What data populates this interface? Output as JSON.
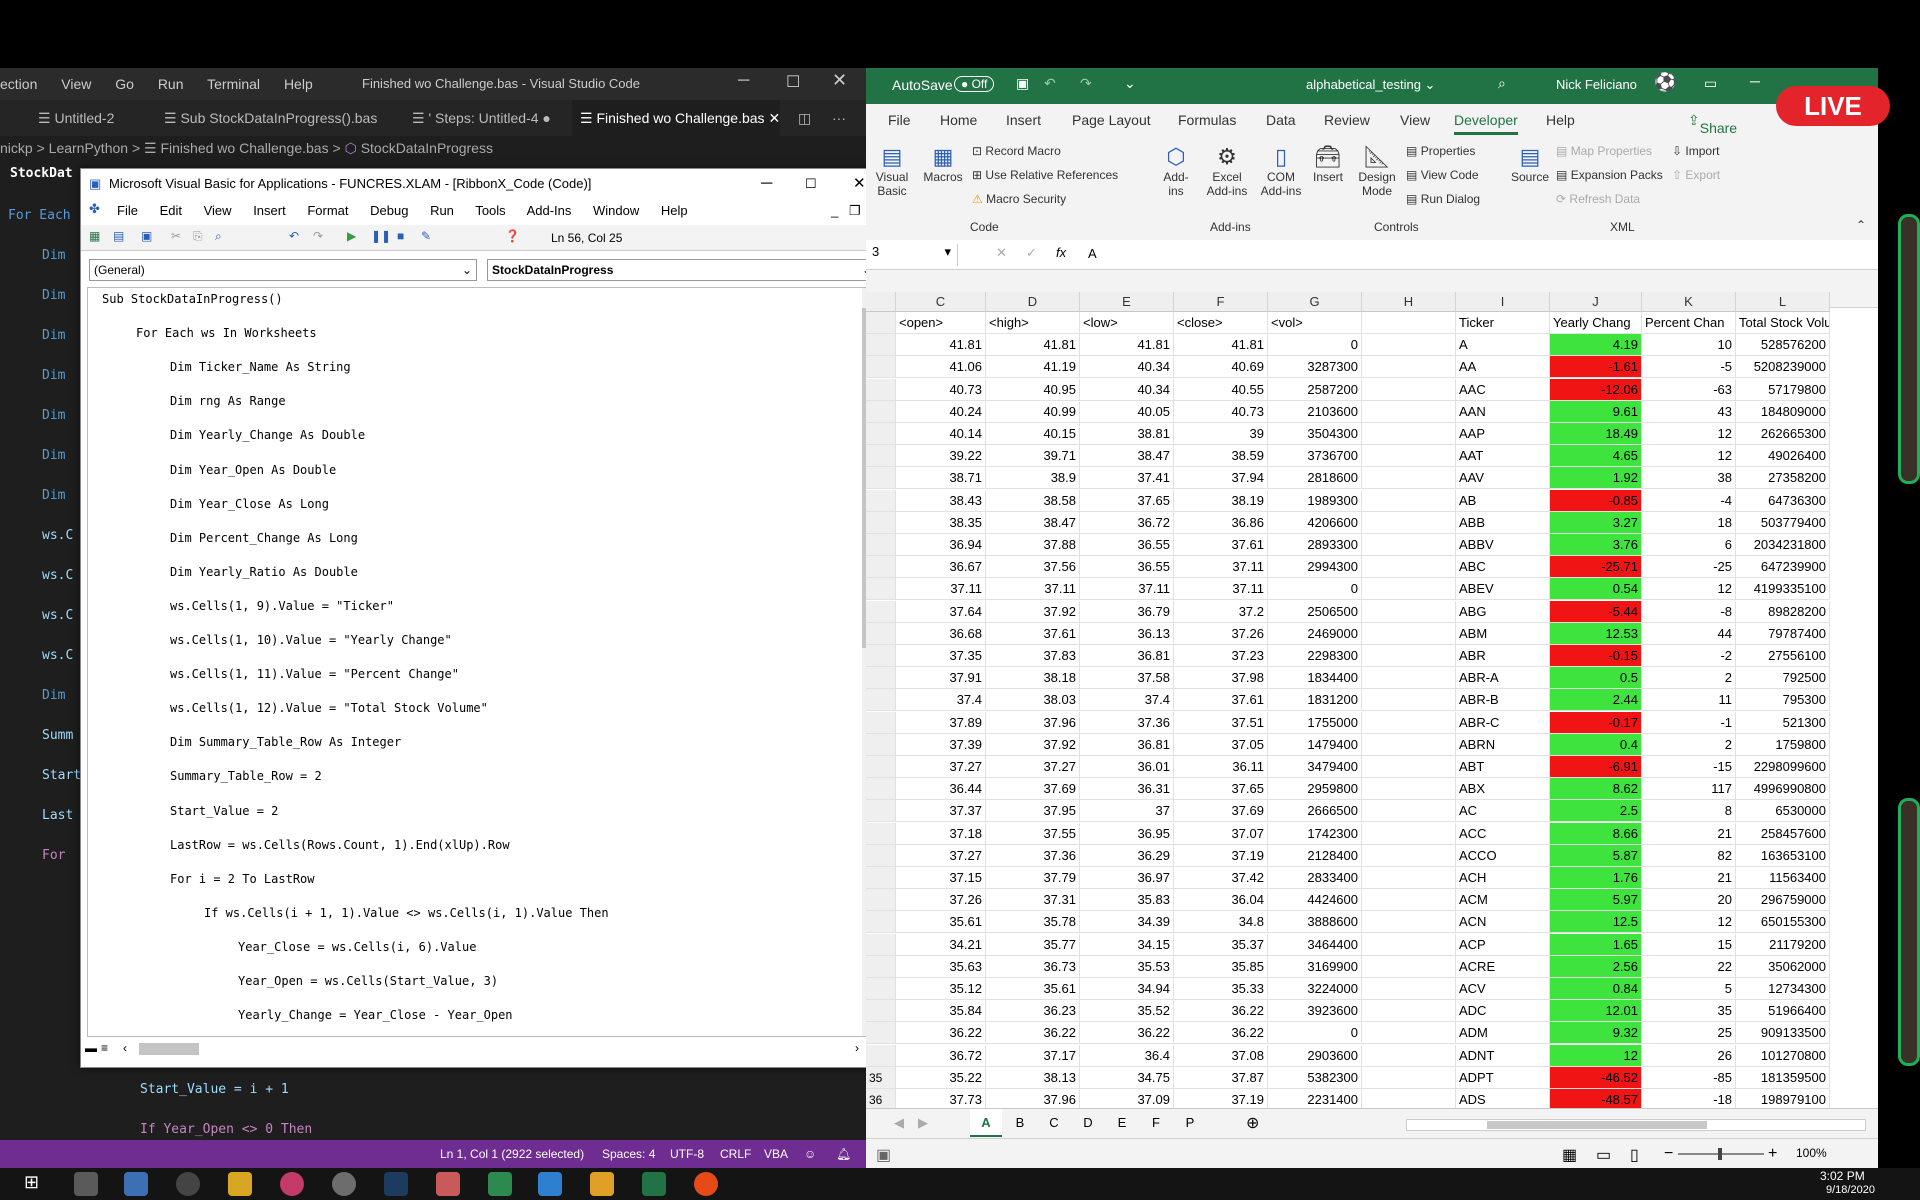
{
  "vscode": {
    "menu": [
      "ection",
      "View",
      "Go",
      "Run",
      "Terminal",
      "Help"
    ],
    "title": "Finished wo Challenge.bas - Visual Studio Code",
    "tabs": [
      "Untitled-2",
      "Sub StockDataInProgress().bas",
      "' Steps: Untitled-4",
      "Finished wo Challenge.bas"
    ],
    "breadcrumb": [
      "nickp",
      "LearnPython",
      "Finished wo Challenge.bas",
      "StockDataInProgress"
    ],
    "outline_label": "StockDat",
    "code_fragments": [
      "For Each",
      "Dim",
      "Dim",
      "Dim",
      "Dim",
      "Dim",
      "Dim",
      "Dim",
      "ws.C",
      "ws.C",
      "ws.C",
      "ws.C",
      "Dim",
      "Summ",
      "Start",
      "Last",
      "For"
    ],
    "bottom_lines": [
      "Start_Value = i + 1",
      "If Year_Open <> 0 Then"
    ],
    "status": [
      "Ln 1, Col 1 (2922 selected)",
      "Spaces: 4",
      "UTF-8",
      "CRLF",
      "VBA"
    ]
  },
  "vba": {
    "title": "Microsoft Visual Basic for Applications - FUNCRES.XLAM - [RibbonX_Code (Code)]",
    "menu": [
      "File",
      "Edit",
      "View",
      "Insert",
      "Format",
      "Debug",
      "Run",
      "Tools",
      "Add-Ins",
      "Window",
      "Help"
    ],
    "position": "Ln 56, Col 25",
    "combo_left": "(General)",
    "combo_right": "StockDataInProgress",
    "code": [
      {
        "indent": 0,
        "text": "Sub StockDataInProgress()"
      },
      {
        "indent": 1,
        "text": "For Each ws In Worksheets"
      },
      {
        "indent": 2,
        "text": "Dim Ticker_Name As String"
      },
      {
        "indent": 2,
        "text": "Dim rng As Range"
      },
      {
        "indent": 2,
        "text": "Dim Yearly_Change As Double"
      },
      {
        "indent": 2,
        "text": "Dim Year_Open As Double"
      },
      {
        "indent": 2,
        "text": "Dim Year_Close As Long"
      },
      {
        "indent": 2,
        "text": "Dim Percent_Change As Long"
      },
      {
        "indent": 2,
        "text": "Dim Yearly_Ratio As Double"
      },
      {
        "indent": 2,
        "text": "ws.Cells(1, 9).Value = \"Ticker\""
      },
      {
        "indent": 2,
        "text": "ws.Cells(1, 10).Value = \"Yearly Change\""
      },
      {
        "indent": 2,
        "text": "ws.Cells(1, 11).Value = \"Percent Change\""
      },
      {
        "indent": 2,
        "text": "ws.Cells(1, 12).Value = \"Total Stock Volume\""
      },
      {
        "indent": 2,
        "text": "Dim Summary_Table_Row As Integer"
      },
      {
        "indent": 2,
        "text": "Summary_Table_Row = 2"
      },
      {
        "indent": 2,
        "text": "Start_Value = 2"
      },
      {
        "indent": 2,
        "text": "LastRow = ws.Cells(Rows.Count, 1).End(xlUp).Row"
      },
      {
        "indent": 2,
        "text": "For i = 2 To LastRow"
      },
      {
        "indent": 3,
        "text": "If ws.Cells(i + 1, 1).Value <> ws.Cells(i, 1).Value Then"
      },
      {
        "indent": 4,
        "text": "Year_Close = ws.Cells(i, 6).Value"
      },
      {
        "indent": 4,
        "text": "Year_Open = ws.Cells(Start_Value, 3)"
      },
      {
        "indent": 4,
        "text": "Yearly_Change = Year_Close - Year_Open"
      }
    ]
  },
  "excel": {
    "autosave": "AutoSave",
    "autosave_state": "Off",
    "filename": "alphabetical_testing",
    "user": "Nick Feliciano",
    "tabs": [
      "File",
      "Home",
      "Insert",
      "Page Layout",
      "Formulas",
      "Data",
      "Review",
      "View",
      "Developer",
      "Help"
    ],
    "share": "Share",
    "ribbon": {
      "code_group": "Code",
      "addins_group": "Add-ins",
      "controls_group": "Controls",
      "xml_group": "XML",
      "items": {
        "visual_basic": "Visual Basic",
        "macros": "Macros",
        "record_macro": "Record Macro",
        "relative": "Use Relative References",
        "security": "Macro Security",
        "addins": "Add-ins",
        "excel_addins": "Excel Add-ins",
        "com_addins": "COM Add-ins",
        "insert": "Insert",
        "design_mode": "Design Mode",
        "properties": "Properties",
        "view_code": "View Code",
        "run_dialog": "Run Dialog",
        "source": "Source",
        "map_properties": "Map Properties",
        "expansion_packs": "Expansion Packs",
        "refresh_data": "Refresh Data",
        "import": "Import",
        "export": "Export"
      }
    },
    "namebox": "3",
    "formula": "A",
    "columns": [
      "C",
      "D",
      "E",
      "F",
      "G",
      "H",
      "I",
      "J",
      "K",
      "L"
    ],
    "header_row": [
      "<open>",
      "<high>",
      "<low>",
      "<close>",
      "<vol>",
      "",
      "Ticker",
      "Yearly Chang",
      "Percent Chan",
      "Total Stock Volum"
    ],
    "rows": [
      [
        "41.81",
        "41.81",
        "41.81",
        "41.81",
        "0",
        "",
        "A",
        "4.19",
        "10",
        "528576200"
      ],
      [
        "41.06",
        "41.19",
        "40.34",
        "40.69",
        "3287300",
        "",
        "AA",
        "-1.61",
        "-5",
        "5208239000"
      ],
      [
        "40.73",
        "40.95",
        "40.34",
        "40.55",
        "2587200",
        "",
        "AAC",
        "-12.06",
        "-63",
        "57179800"
      ],
      [
        "40.24",
        "40.99",
        "40.05",
        "40.73",
        "2103600",
        "",
        "AAN",
        "9.61",
        "43",
        "184809000"
      ],
      [
        "40.14",
        "40.15",
        "38.81",
        "39",
        "3504300",
        "",
        "AAP",
        "18.49",
        "12",
        "262665300"
      ],
      [
        "39.22",
        "39.71",
        "38.47",
        "38.59",
        "3736700",
        "",
        "AAT",
        "4.65",
        "12",
        "49026400"
      ],
      [
        "38.71",
        "38.9",
        "37.41",
        "37.94",
        "2818600",
        "",
        "AAV",
        "1.92",
        "38",
        "27358200"
      ],
      [
        "38.43",
        "38.58",
        "37.65",
        "38.19",
        "1989300",
        "",
        "AB",
        "-0.85",
        "-4",
        "64736300"
      ],
      [
        "38.35",
        "38.47",
        "36.72",
        "36.86",
        "4206600",
        "",
        "ABB",
        "3.27",
        "18",
        "503779400"
      ],
      [
        "36.94",
        "37.88",
        "36.55",
        "37.61",
        "2893300",
        "",
        "ABBV",
        "3.76",
        "6",
        "2034231800"
      ],
      [
        "36.67",
        "37.56",
        "36.55",
        "37.11",
        "2994300",
        "",
        "ABC",
        "-25.71",
        "-25",
        "647239900"
      ],
      [
        "37.11",
        "37.11",
        "37.11",
        "37.11",
        "0",
        "",
        "ABEV",
        "0.54",
        "12",
        "4199335100"
      ],
      [
        "37.64",
        "37.92",
        "36.79",
        "37.2",
        "2506500",
        "",
        "ABG",
        "-5.44",
        "-8",
        "89828200"
      ],
      [
        "36.68",
        "37.61",
        "36.13",
        "37.26",
        "2469000",
        "",
        "ABM",
        "12.53",
        "44",
        "79787400"
      ],
      [
        "37.35",
        "37.83",
        "36.81",
        "37.23",
        "2298300",
        "",
        "ABR",
        "-0.15",
        "-2",
        "27556100"
      ],
      [
        "37.91",
        "38.18",
        "37.58",
        "37.98",
        "1834400",
        "",
        "ABR-A",
        "0.5",
        "2",
        "792500"
      ],
      [
        "37.4",
        "38.03",
        "37.4",
        "37.61",
        "1831200",
        "",
        "ABR-B",
        "2.44",
        "11",
        "795300"
      ],
      [
        "37.89",
        "37.96",
        "37.36",
        "37.51",
        "1755000",
        "",
        "ABR-C",
        "-0.17",
        "-1",
        "521300"
      ],
      [
        "37.39",
        "37.92",
        "36.81",
        "37.05",
        "1479400",
        "",
        "ABRN",
        "0.4",
        "2",
        "1759800"
      ],
      [
        "37.27",
        "37.27",
        "36.01",
        "36.11",
        "3479400",
        "",
        "ABT",
        "-6.91",
        "-15",
        "2298099600"
      ],
      [
        "36.44",
        "37.69",
        "36.31",
        "37.65",
        "2959800",
        "",
        "ABX",
        "8.62",
        "117",
        "4996990800"
      ],
      [
        "37.37",
        "37.95",
        "37",
        "37.69",
        "2666500",
        "",
        "AC",
        "2.5",
        "8",
        "6530000"
      ],
      [
        "37.18",
        "37.55",
        "36.95",
        "37.07",
        "1742300",
        "",
        "ACC",
        "8.66",
        "21",
        "258457600"
      ],
      [
        "37.27",
        "37.36",
        "36.29",
        "37.19",
        "2128400",
        "",
        "ACCO",
        "5.87",
        "82",
        "163653100"
      ],
      [
        "37.15",
        "37.79",
        "36.97",
        "37.42",
        "2833400",
        "",
        "ACH",
        "1.76",
        "21",
        "11563400"
      ],
      [
        "37.26",
        "37.31",
        "35.83",
        "36.04",
        "4424600",
        "",
        "ACM",
        "5.97",
        "20",
        "296759000"
      ],
      [
        "35.61",
        "35.78",
        "34.39",
        "34.8",
        "3888600",
        "",
        "ACN",
        "12.5",
        "12",
        "650155300"
      ],
      [
        "34.21",
        "35.77",
        "34.15",
        "35.37",
        "3464400",
        "",
        "ACP",
        "1.65",
        "15",
        "21179200"
      ],
      [
        "35.63",
        "36.73",
        "35.53",
        "35.85",
        "3169900",
        "",
        "ACRE",
        "2.56",
        "22",
        "35062000"
      ],
      [
        "35.12",
        "35.61",
        "34.94",
        "35.33",
        "3224000",
        "",
        "ACV",
        "0.84",
        "5",
        "12734300"
      ],
      [
        "35.84",
        "36.23",
        "35.52",
        "36.22",
        "3923600",
        "",
        "ADC",
        "12.01",
        "35",
        "51966400"
      ],
      [
        "36.22",
        "36.22",
        "36.22",
        "36.22",
        "0",
        "",
        "ADM",
        "9.32",
        "25",
        "909133500"
      ],
      [
        "36.72",
        "37.17",
        "36.4",
        "37.08",
        "2903600",
        "",
        "ADNT",
        "12",
        "26",
        "101270800"
      ],
      [
        "35.22",
        "38.13",
        "34.75",
        "37.87",
        "5382300",
        "",
        "ADPT",
        "-46.52",
        "-85",
        "181359500"
      ],
      [
        "37.73",
        "37.96",
        "37.09",
        "37.19",
        "2231400",
        "",
        "ADS",
        "-48.57",
        "-18",
        "198979100"
      ]
    ],
    "row_numbers_tail": [
      "35",
      "36"
    ],
    "sheets": [
      "A",
      "B",
      "C",
      "D",
      "E",
      "F",
      "P"
    ],
    "zoom": "100%",
    "colors": {
      "positive": "#3ee33e",
      "negative": "#f01414"
    }
  },
  "live": "LIVE",
  "clock": {
    "time": "3:02 PM",
    "date": "9/18/2020"
  }
}
